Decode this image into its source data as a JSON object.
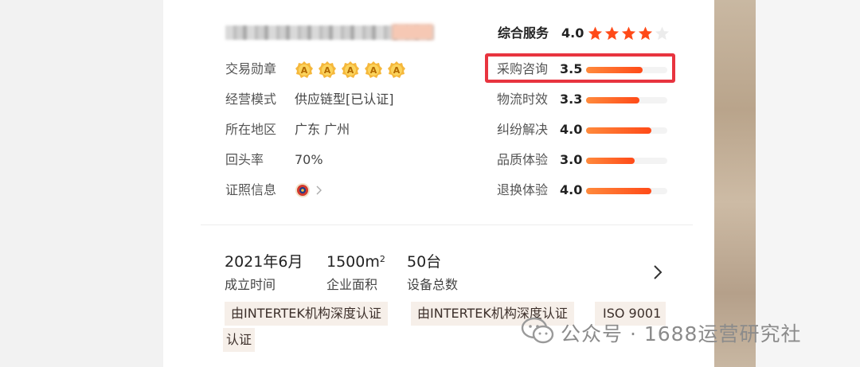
{
  "profile": {
    "badges_label": "交易勋章",
    "badge_icons": [
      "a-medal-icon",
      "a-medal-icon",
      "a-medal-icon",
      "a-medal-icon",
      "a-medal-icon"
    ],
    "business_model_label": "经营模式",
    "business_model_value": "供应链型[已认证]",
    "region_label": "所在地区",
    "region_value": "广东 广州",
    "repurchase_label": "回头率",
    "repurchase_value": "70%",
    "license_label": "证照信息"
  },
  "service": {
    "title": "综合服务",
    "score": "4.0",
    "stars_filled": 4,
    "stars_total": 5,
    "metrics": [
      {
        "label": "采购咨询",
        "value": "3.5",
        "level": 0.7
      },
      {
        "label": "物流时效",
        "value": "3.3",
        "level": 0.66
      },
      {
        "label": "纠纷解决",
        "value": "4.0",
        "level": 0.8
      },
      {
        "label": "品质体验",
        "value": "3.0",
        "level": 0.6
      },
      {
        "label": "退换体验",
        "value": "4.0",
        "level": 0.8
      }
    ],
    "highlighted_metric": "采购咨询"
  },
  "stats": [
    {
      "value": "2021年6月",
      "label": "成立时间"
    },
    {
      "value": "1500m",
      "sup": "2",
      "label": "企业面积"
    },
    {
      "value": "50台",
      "label": "设备总数"
    }
  ],
  "tags": [
    "由INTERTEK机构深度认证",
    "由INTERTEK机构深度认证",
    "ISO 9001",
    "认证"
  ],
  "watermark": {
    "text": "公众号 · 1688运营研究社"
  },
  "colors": {
    "accent": "#ff4a18",
    "highlight_border": "#e8343f",
    "tag_bg": "#f6efe9",
    "star": "#ff4a18"
  }
}
